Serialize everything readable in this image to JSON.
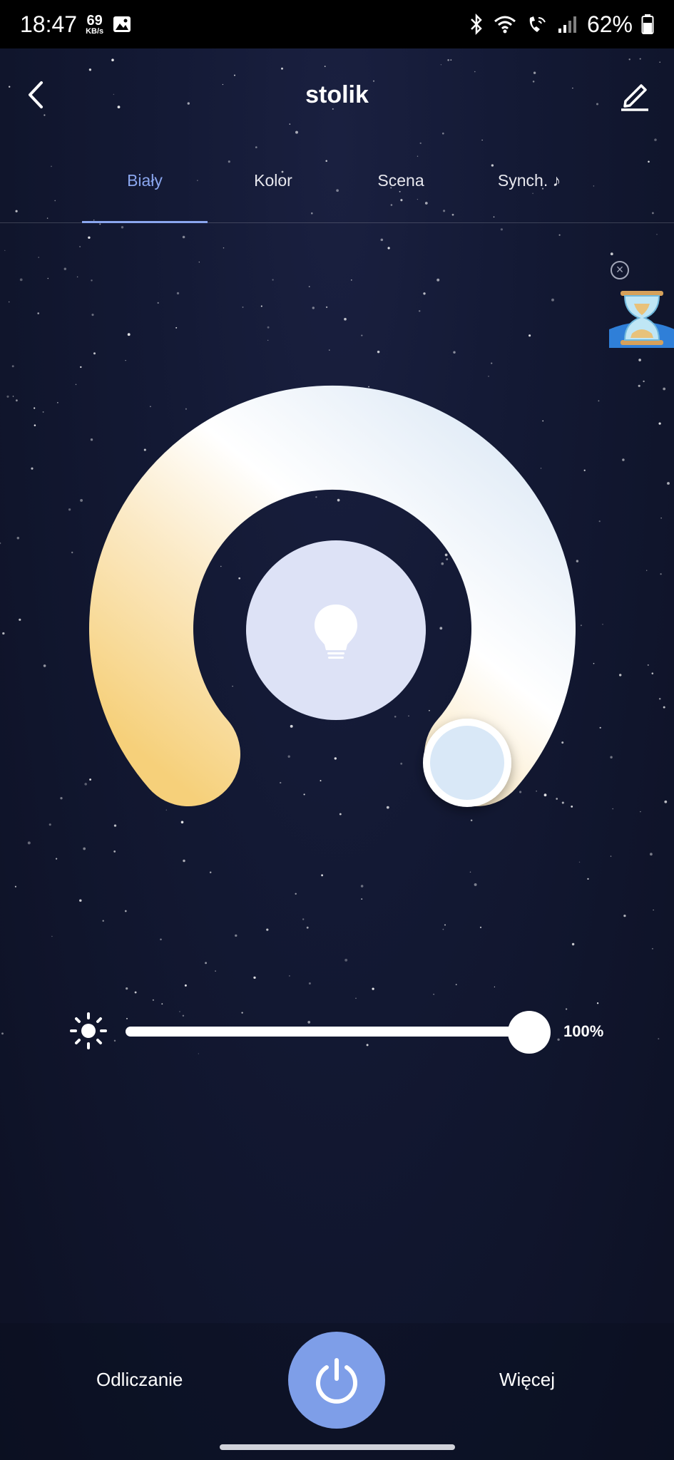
{
  "status_bar": {
    "time": "18:47",
    "net_speed_value": "69",
    "net_speed_unit": "KB/s",
    "battery": "62%"
  },
  "header": {
    "title": "stolik"
  },
  "tabs": [
    {
      "label": "Biały",
      "active": true
    },
    {
      "label": "Kolor",
      "active": false
    },
    {
      "label": "Scena",
      "active": false
    },
    {
      "label": "Synch. ♪",
      "active": false
    }
  ],
  "brightness": {
    "value_label": "100%",
    "value": 1.0
  },
  "bottom_bar": {
    "left_label": "Odliczanie",
    "right_label": "Więcej"
  },
  "colors": {
    "accent": "#8aa6ee",
    "power_button": "#7e9ee8",
    "warm": "#f6d07a",
    "cool": "#e4eef8",
    "center_circle": "#dde2f6"
  },
  "icons": {
    "back": "chevron-left-icon",
    "edit": "pencil-icon",
    "bulb": "lightbulb-icon",
    "sun": "sun-icon",
    "power": "power-icon",
    "timer": "hourglass-icon",
    "close": "close-icon"
  }
}
